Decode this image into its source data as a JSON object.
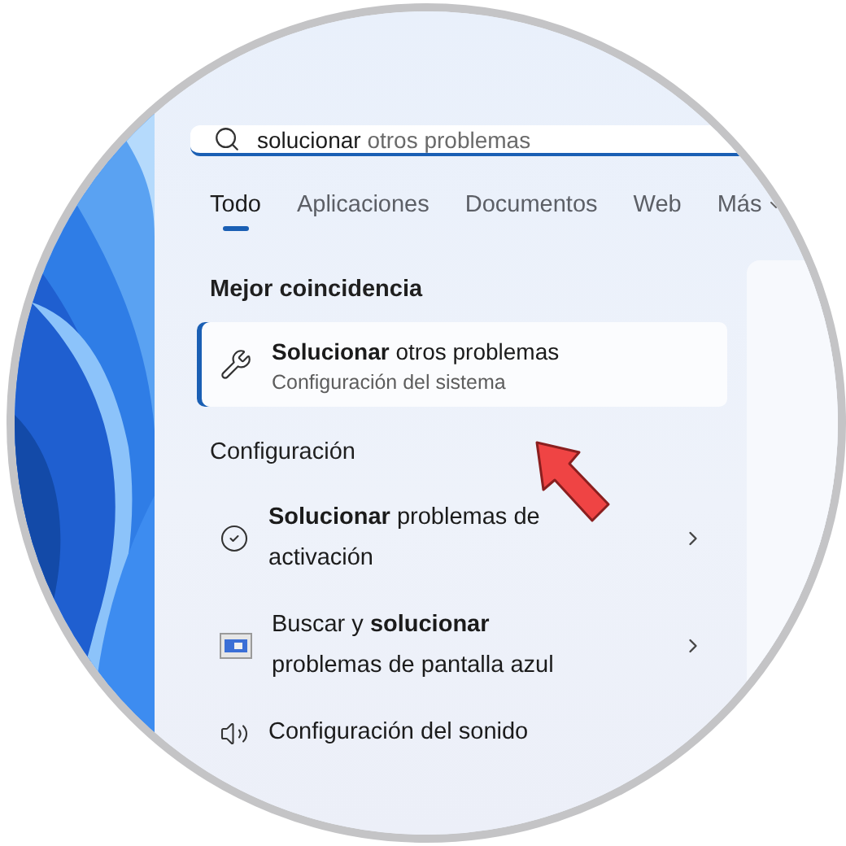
{
  "search": {
    "typed": "solucionar",
    "suggestion": "otros problemas"
  },
  "tabs": [
    {
      "label": "Todo",
      "selected": true,
      "kind": "tab"
    },
    {
      "label": "Aplicaciones",
      "selected": false,
      "kind": "tab"
    },
    {
      "label": "Documentos",
      "selected": false,
      "kind": "tab"
    },
    {
      "label": "Web",
      "selected": false,
      "kind": "tab"
    },
    {
      "label": "Más",
      "selected": false,
      "kind": "menu"
    }
  ],
  "best_match": {
    "heading": "Mejor coincidencia",
    "title": "**Solucionar** otros problemas",
    "subtitle": "Configuración del sistema",
    "selected": true
  },
  "settings": {
    "heading": "Configuración",
    "items": [
      {
        "kind": "check",
        "title": "**Solucionar** problemas de activación",
        "chevron": true
      },
      {
        "kind": "screen",
        "title": "Buscar y **solucionar** problemas de pantalla azul",
        "chevron": true
      },
      {
        "kind": "sound",
        "title": "Configuración del sonido",
        "chevron": false
      }
    ]
  }
}
